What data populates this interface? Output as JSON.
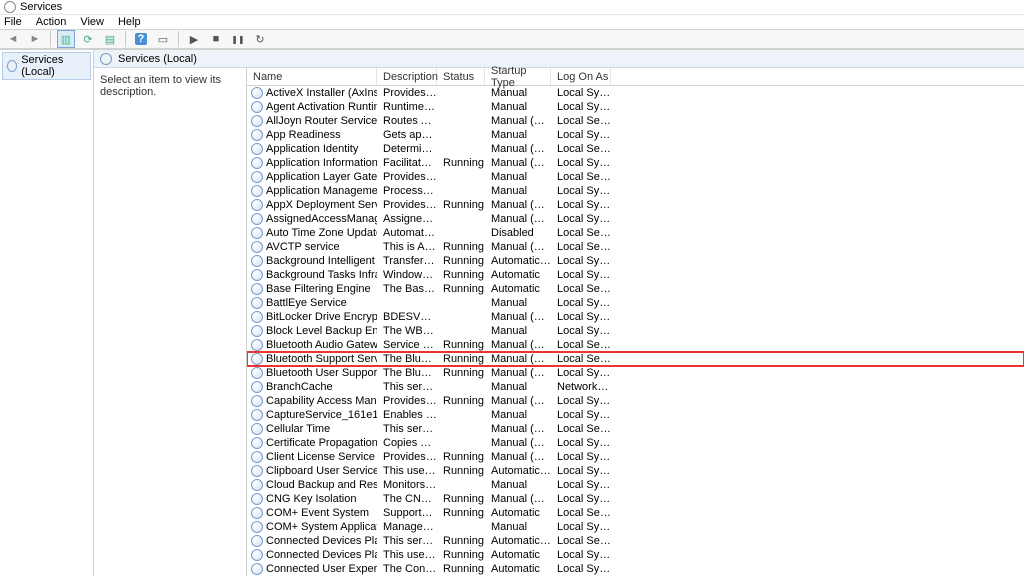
{
  "window": {
    "title": "Services"
  },
  "menu": [
    "File",
    "Action",
    "View",
    "Help"
  ],
  "tree": {
    "root": "Services (Local)"
  },
  "panel": {
    "header": "Services (Local)",
    "hint": "Select an item to view its description."
  },
  "columns": [
    "Name",
    "Description",
    "Status",
    "Startup Type",
    "Log On As"
  ],
  "highlight_index": 20,
  "services": [
    {
      "n": "ActiveX Installer (AxInstSV)",
      "d": "Provides Us...",
      "s": "",
      "t": "Manual",
      "l": "Local Syste..."
    },
    {
      "n": "Agent Activation Runtime_...",
      "d": "Runtime for...",
      "s": "",
      "t": "Manual",
      "l": "Local Syste..."
    },
    {
      "n": "AllJoyn Router Service",
      "d": "Routes AllJo...",
      "s": "",
      "t": "Manual (Trig...",
      "l": "Local Service"
    },
    {
      "n": "App Readiness",
      "d": "Gets apps re...",
      "s": "",
      "t": "Manual",
      "l": "Local Syste..."
    },
    {
      "n": "Application Identity",
      "d": "Determines ...",
      "s": "",
      "t": "Manual (Trig...",
      "l": "Local Service"
    },
    {
      "n": "Application Information",
      "d": "Facilitates t...",
      "s": "Running",
      "t": "Manual (Trig...",
      "l": "Local Syste..."
    },
    {
      "n": "Application Layer Gateway ...",
      "d": "Provides su...",
      "s": "",
      "t": "Manual",
      "l": "Local Service"
    },
    {
      "n": "Application Management",
      "d": "Processes in...",
      "s": "",
      "t": "Manual",
      "l": "Local Syste..."
    },
    {
      "n": "AppX Deployment Service (...",
      "d": "Provides inf...",
      "s": "Running",
      "t": "Manual (Trig...",
      "l": "Local Syste..."
    },
    {
      "n": "AssignedAccessManager Se...",
      "d": "AssignedAc...",
      "s": "",
      "t": "Manual (Trig...",
      "l": "Local Syste..."
    },
    {
      "n": "Auto Time Zone Updater",
      "d": "Automatica...",
      "s": "",
      "t": "Disabled",
      "l": "Local Service"
    },
    {
      "n": "AVCTP service",
      "d": "This is Audi...",
      "s": "Running",
      "t": "Manual (Trig...",
      "l": "Local Service"
    },
    {
      "n": "Background Intelligent Tran...",
      "d": "Transfers fil...",
      "s": "Running",
      "t": "Automatic (...",
      "l": "Local Syste..."
    },
    {
      "n": "Background Tasks Infrastruc...",
      "d": "Windows in...",
      "s": "Running",
      "t": "Automatic",
      "l": "Local Syste..."
    },
    {
      "n": "Base Filtering Engine",
      "d": "The Base Fil...",
      "s": "Running",
      "t": "Automatic",
      "l": "Local Service"
    },
    {
      "n": "BattlEye Service",
      "d": "",
      "s": "",
      "t": "Manual",
      "l": "Local Syste..."
    },
    {
      "n": "BitLocker Drive Encryption ...",
      "d": "BDESVC hos...",
      "s": "",
      "t": "Manual (Trig...",
      "l": "Local Syste..."
    },
    {
      "n": "Block Level Backup Engine ...",
      "d": "The WBENG...",
      "s": "",
      "t": "Manual",
      "l": "Local Syste..."
    },
    {
      "n": "Bluetooth Audio Gateway S...",
      "d": "Service sup...",
      "s": "Running",
      "t": "Manual (Trig...",
      "l": "Local Service"
    },
    {
      "n": "Bluetooth Support Service",
      "d": "The Bluetoo...",
      "s": "Running",
      "t": "Manual (Trig...",
      "l": "Local Service"
    },
    {
      "n": "Bluetooth User Support Ser...",
      "d": "The Bluetoo...",
      "s": "Running",
      "t": "Manual (Trig...",
      "l": "Local Syste..."
    },
    {
      "n": "BranchCache",
      "d": "This service ...",
      "s": "",
      "t": "Manual",
      "l": "Network S..."
    },
    {
      "n": "Capability Access Manager ...",
      "d": "Provides fac...",
      "s": "Running",
      "t": "Manual (Trig...",
      "l": "Local Syste..."
    },
    {
      "n": "CaptureService_161e1c",
      "d": "Enables opti...",
      "s": "",
      "t": "Manual",
      "l": "Local Syste..."
    },
    {
      "n": "Cellular Time",
      "d": "This service ...",
      "s": "",
      "t": "Manual (Trig...",
      "l": "Local Service"
    },
    {
      "n": "Certificate Propagation",
      "d": "Copies user ...",
      "s": "",
      "t": "Manual (Trig...",
      "l": "Local Syste..."
    },
    {
      "n": "Client License Service (ClipS...",
      "d": "Provides inf...",
      "s": "Running",
      "t": "Manual (Trig...",
      "l": "Local Syste..."
    },
    {
      "n": "Clipboard User Service_161e...",
      "d": "This user ser...",
      "s": "Running",
      "t": "Automatic (...",
      "l": "Local Syste..."
    },
    {
      "n": "Cloud Backup and Restore ...",
      "d": "Monitors th...",
      "s": "",
      "t": "Manual",
      "l": "Local Syste..."
    },
    {
      "n": "CNG Key Isolation",
      "d": "The CNG ke...",
      "s": "Running",
      "t": "Manual (Trig...",
      "l": "Local Syste..."
    },
    {
      "n": "COM+ Event System",
      "d": "Supports Sy...",
      "s": "Running",
      "t": "Automatic",
      "l": "Local Service"
    },
    {
      "n": "COM+ System Application",
      "d": "Manages th...",
      "s": "",
      "t": "Manual",
      "l": "Local Syste..."
    },
    {
      "n": "Connected Devices Platfor...",
      "d": "This service ...",
      "s": "Running",
      "t": "Automatic (...",
      "l": "Local Service"
    },
    {
      "n": "Connected Devices Platfor...",
      "d": "This user ser...",
      "s": "Running",
      "t": "Automatic",
      "l": "Local Syste..."
    },
    {
      "n": "Connected User Experience...",
      "d": "The Connec...",
      "s": "Running",
      "t": "Automatic",
      "l": "Local Syste..."
    }
  ]
}
